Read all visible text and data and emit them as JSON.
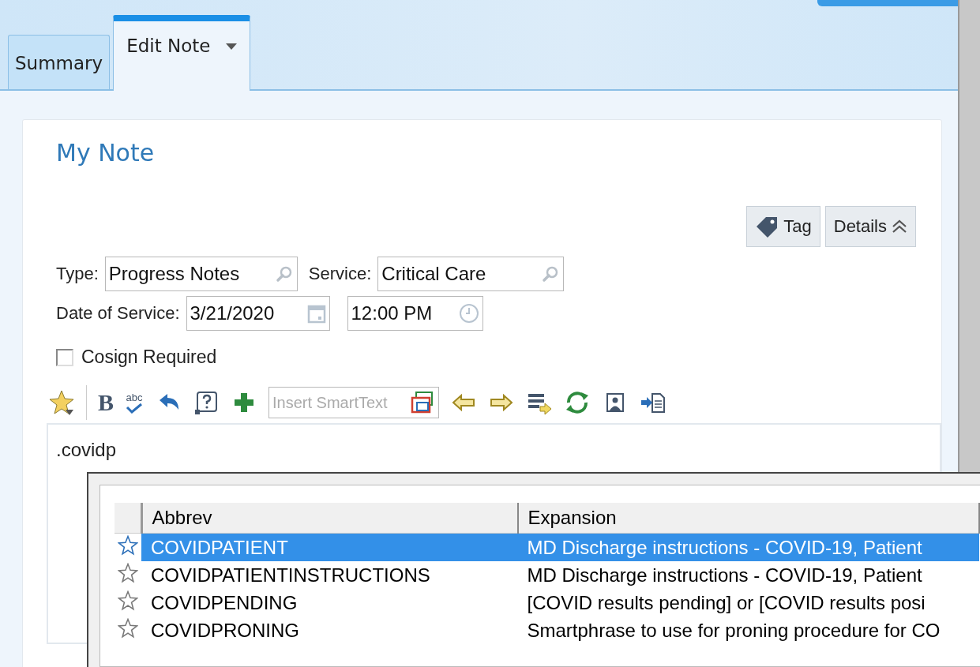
{
  "tabs": [
    {
      "label": "Summary",
      "selected": false,
      "dropdown": false
    },
    {
      "label": "Edit Note",
      "selected": true,
      "dropdown": true
    }
  ],
  "note": {
    "title": "My Note",
    "buttons": [
      {
        "kind": "tag",
        "label": "Tag"
      },
      {
        "kind": "details",
        "label": "Details"
      }
    ],
    "type": {
      "label": "Type:",
      "value": "Progress Notes"
    },
    "service": {
      "label": "Service:",
      "value": "Critical Care"
    },
    "date": {
      "label": "Date of Service:",
      "value": "3/21/2020",
      "time": "12:00 PM"
    },
    "cosign": {
      "label": "Cosign Required",
      "checked": false
    },
    "toolbar": [
      {
        "kind": "star"
      },
      {
        "kind": "sep"
      },
      {
        "kind": "bold",
        "label": "B"
      },
      {
        "kind": "spell",
        "label": "abc"
      },
      {
        "kind": "undo"
      },
      {
        "kind": "help"
      },
      {
        "kind": "plus"
      },
      {
        "kind": "smarttext",
        "placeholder": "Insert SmartText"
      },
      {
        "kind": "left"
      },
      {
        "kind": "right"
      },
      {
        "kind": "list"
      },
      {
        "kind": "refresh"
      },
      {
        "kind": "portrait"
      },
      {
        "kind": "import"
      }
    ],
    "text": ".covidp"
  },
  "popup": {
    "columns": [
      "Abbrev",
      "Expansion"
    ],
    "rows": [
      {
        "abbrev": "COVIDPATIENT",
        "expansion": "MD Discharge instructions - COVID-19, Patient",
        "selected": true
      },
      {
        "abbrev": "COVIDPATIENTINSTRUCTIONS",
        "expansion": "MD Discharge instructions - COVID-19, Patient",
        "selected": false
      },
      {
        "abbrev": "COVIDPENDING",
        "expansion": "[COVID results pending] or [COVID results posi",
        "selected": false
      },
      {
        "abbrev": "COVIDPRONING",
        "expansion": "Smartphrase to use for proning procedure for CO",
        "selected": false
      }
    ]
  }
}
